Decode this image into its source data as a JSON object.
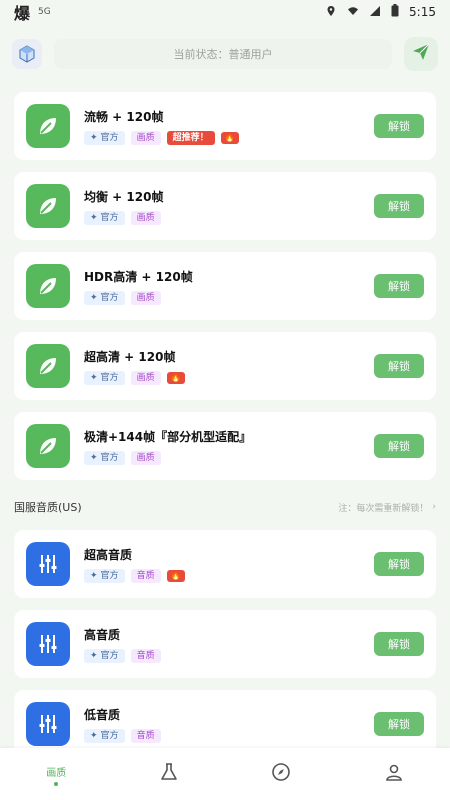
{
  "statusbar": {
    "app_glyph": "爆",
    "net_label": "5G",
    "time": "5:15",
    "icons": [
      "location-icon",
      "wifi-icon",
      "signal-icon",
      "battery-icon"
    ]
  },
  "topbar": {
    "status_text": "当前状态：普通用户"
  },
  "cards": [
    {
      "title": "流畅 + 120帧",
      "icon": "leaf-icon",
      "tags": {
        "official": "官方",
        "type": "画质",
        "recommend": "超推荐！",
        "hot": true
      },
      "button": "解锁"
    },
    {
      "title": "均衡 + 120帧",
      "icon": "leaf-icon",
      "tags": {
        "official": "官方",
        "type": "画质"
      },
      "button": "解锁"
    },
    {
      "title": "HDR高清 + 120帧",
      "icon": "leaf-icon",
      "tags": {
        "official": "官方",
        "type": "画质"
      },
      "button": "解锁"
    },
    {
      "title": "超高清 + 120帧",
      "icon": "leaf-icon",
      "tags": {
        "official": "官方",
        "type": "画质",
        "hot": true
      },
      "button": "解锁"
    },
    {
      "title": "极清+144帧『部分机型适配』",
      "icon": "leaf-icon",
      "tags": {
        "official": "官方",
        "type": "画质"
      },
      "button": "解锁"
    }
  ],
  "section": {
    "label": "国服音质(US)",
    "note": "注：每次需重新解锁！"
  },
  "audio_cards": [
    {
      "title": "超高音质",
      "icon": "equalizer-icon",
      "tags": {
        "official": "官方",
        "type": "音质",
        "hot": true
      },
      "button": "解锁"
    },
    {
      "title": "高音质",
      "icon": "equalizer-icon",
      "tags": {
        "official": "官方",
        "type": "音质"
      },
      "button": "解锁"
    },
    {
      "title": "低音质",
      "icon": "equalizer-icon",
      "tags": {
        "official": "官方",
        "type": "音质"
      },
      "button": "解锁"
    }
  ],
  "bottomnav": {
    "active_label": "画质",
    "items": [
      "home-icon",
      "flask-icon",
      "compass-icon",
      "user-icon"
    ]
  },
  "colors": {
    "accent": "#58b85c",
    "blue": "#2f6fe4",
    "hot": "#e64b3c"
  }
}
